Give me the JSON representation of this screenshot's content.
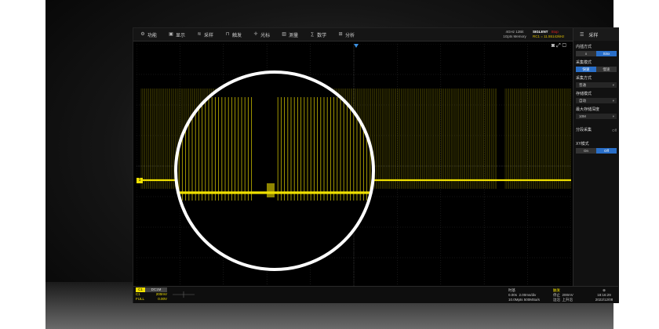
{
  "menu": [
    {
      "icon": "gear-icon",
      "glyph": "⚙",
      "label": "功能"
    },
    {
      "icon": "display-icon",
      "glyph": "▣",
      "label": "显示"
    },
    {
      "icon": "acquire-icon",
      "glyph": "≋",
      "label": "采样"
    },
    {
      "icon": "trigger-icon",
      "glyph": "⊓",
      "label": "触发"
    },
    {
      "icon": "cursor-icon",
      "glyph": "✛",
      "label": "光标"
    },
    {
      "icon": "measure-icon",
      "glyph": "▥",
      "label": "测量"
    },
    {
      "icon": "math-icon",
      "glyph": "∑",
      "label": "数学"
    },
    {
      "icon": "analysis-icon",
      "glyph": "⊞",
      "label": "分析"
    }
  ],
  "status": {
    "spec_line1": "4GHz 12Bit",
    "spec_line2": "1Gpts Memory",
    "brand": "SIGLENT",
    "run_state": "Stop",
    "trigger_info": "RC1 = 11.55142kHz"
  },
  "panel": {
    "title": "采样",
    "sections": {
      "interp_label": "内插方式",
      "interp_options": [
        "x",
        "Sinx"
      ],
      "acq_mode_label": "采集模式",
      "acq_mode_options": [
        "快速",
        "慢速"
      ],
      "sample_method_label": "采集方式",
      "sample_method_value": "普通",
      "storage_mode_label": "存储模式",
      "storage_mode_value": "自动",
      "max_depth_label": "最大存储深度",
      "max_depth_value": "10M",
      "segmented_label": "分段采集",
      "segmented_value": "Off",
      "xy_label": "XY模式",
      "xy_options": [
        "On",
        "Off"
      ]
    }
  },
  "channel": {
    "tag": "C1",
    "coupling": "DC1M",
    "scale": "200mV",
    "offset_label": "FULL",
    "offset_value": "0.00V"
  },
  "timebase": {
    "title": "时基",
    "delay": "0.00s",
    "scale": "2.00ms/div",
    "sample_rate": "10.0Mpts",
    "memory": "500MSa/s"
  },
  "trigger": {
    "title": "触发",
    "mode": "停止",
    "type": "边沿",
    "level": "200mV",
    "slope": "上升沿"
  },
  "clock": {
    "time": "18:16:29",
    "date": "2022/12/08"
  },
  "colors": {
    "trace": "#f0e000",
    "accent": "#2a6fc8",
    "stop": "#e02020"
  }
}
